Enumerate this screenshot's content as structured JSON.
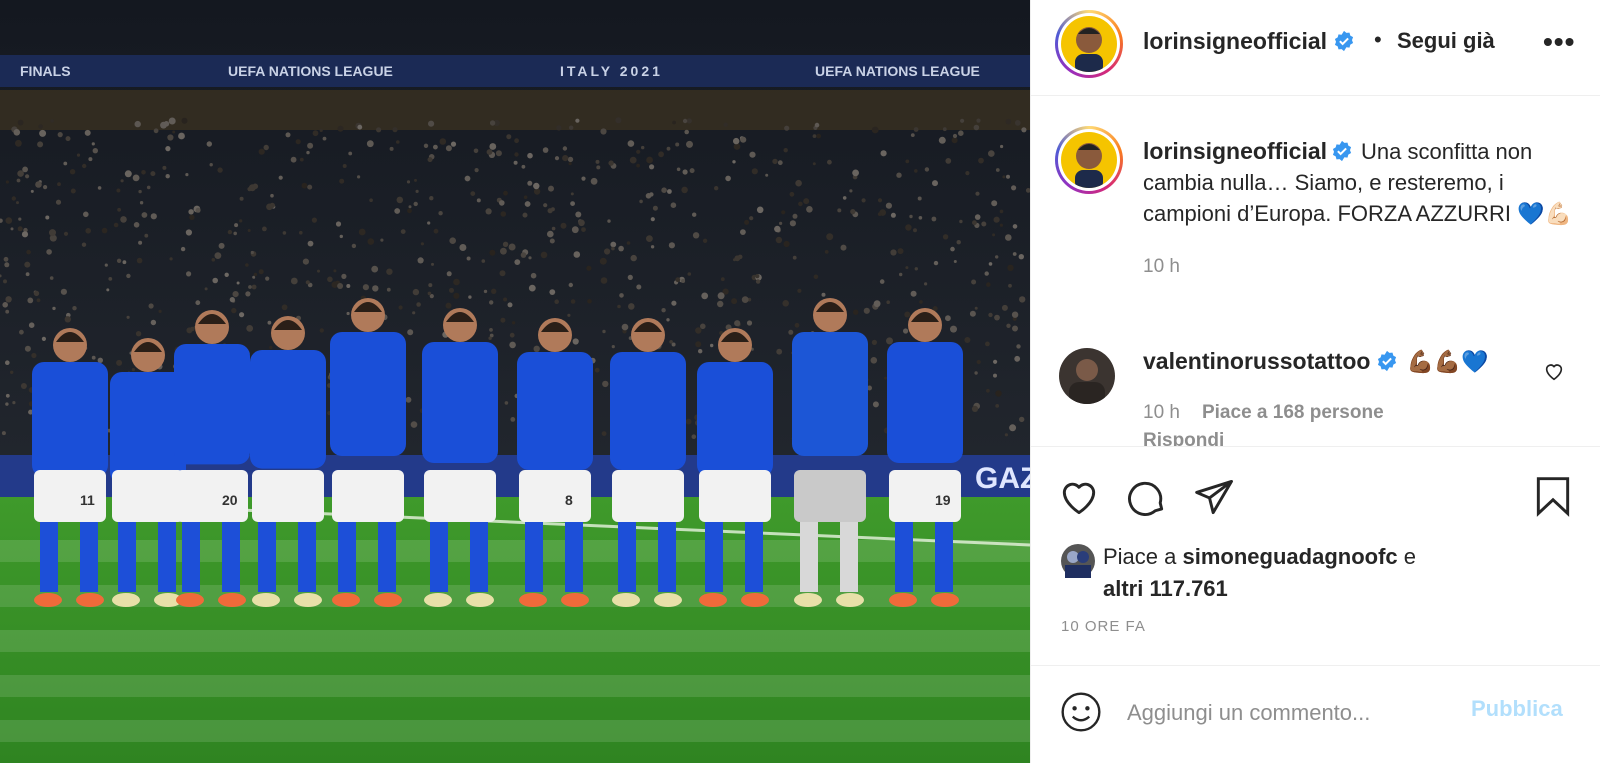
{
  "post": {
    "username": "lorinsigneofficial",
    "follow_status": "Segui già",
    "separator": "•",
    "more": "•••"
  },
  "media": {
    "banner_texts": [
      "FINALS",
      "UEFA NATIONS LEAGUE",
      "ITALY 2021",
      "UEFA NATIONS LEAGUE"
    ],
    "jersey_numbers": [
      "11",
      "",
      "20",
      "",
      "",
      "",
      "8",
      "",
      "",
      "",
      "19"
    ],
    "ad_text": "GAZ"
  },
  "caption": {
    "username": "lorinsigneofficial",
    "text": "Una sconfitta non cambia nulla… Siamo, e resteremo, i campioni d’Europa. FORZA AZZURRI 💙💪🏻",
    "time": "10 h"
  },
  "comments": [
    {
      "username": "valentinorussotattoo",
      "text": "💪🏾💪🏾💙",
      "time": "10 h",
      "likes": "Piace a 168 persone",
      "reply": "Rispondi"
    }
  ],
  "likes": {
    "prefix": "Piace a",
    "user": "simoneguadagnoofc",
    "conj": "e",
    "others": "altri 117.761"
  },
  "date": "10 ORE FA",
  "add_comment": {
    "placeholder": "Aggiungi un commento...",
    "publish": "Pubblica"
  },
  "colors": {
    "verified": "#3897f0",
    "publish_disabled": "#b2dffc",
    "jersey": "#1a4fd8"
  }
}
